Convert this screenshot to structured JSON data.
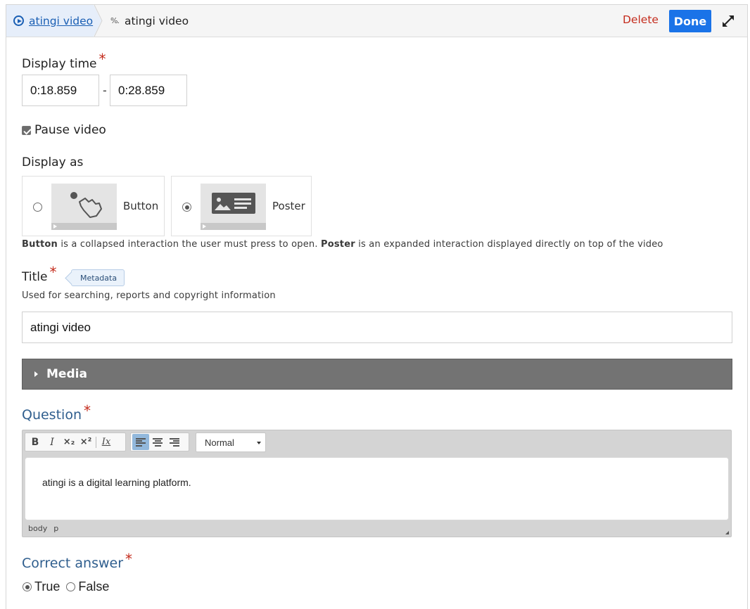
{
  "breadcrumb": {
    "root_label": "atingi video",
    "current_icon": "%.",
    "current_label": "atingi video"
  },
  "actions": {
    "delete_label": "Delete",
    "done_label": "Done"
  },
  "display_time": {
    "label": "Display time",
    "required_mark": "*",
    "start": "0:18.859",
    "separator": "-",
    "end": "0:28.859"
  },
  "pause_video": {
    "label": "Pause video",
    "checked": true
  },
  "display_as": {
    "label": "Display as",
    "options": [
      {
        "label": "Button",
        "selected": false
      },
      {
        "label": "Poster",
        "selected": true
      }
    ],
    "desc_button_bold": "Button",
    "desc_button_text": " is a collapsed interaction the user must press to open. ",
    "desc_poster_bold": "Poster",
    "desc_poster_text": " is an expanded interaction displayed directly on top of the video"
  },
  "title_field": {
    "label": "Title",
    "required_mark": "*",
    "tag": "Metadata",
    "help": "Used for searching, reports and copyright information",
    "value": "atingi video"
  },
  "media": {
    "label": "Media"
  },
  "question": {
    "label": "Question",
    "required_mark": "*",
    "toolbar": {
      "bold": "B",
      "italic": "I",
      "subscript": "×₂",
      "superscript": "×²",
      "clear_format": "Ix",
      "format_value": "Normal"
    },
    "content": "atingi is a digital learning platform.",
    "path": [
      "body",
      "p"
    ]
  },
  "correct_answer": {
    "label": "Correct answer",
    "required_mark": "*",
    "options": [
      {
        "label": "True",
        "selected": true
      },
      {
        "label": "False",
        "selected": false
      }
    ]
  },
  "colors": {
    "accent_blue": "#1a73e8",
    "link_blue": "#1a5fb4",
    "delete_red": "#c42b1c",
    "media_bar": "#737373"
  }
}
